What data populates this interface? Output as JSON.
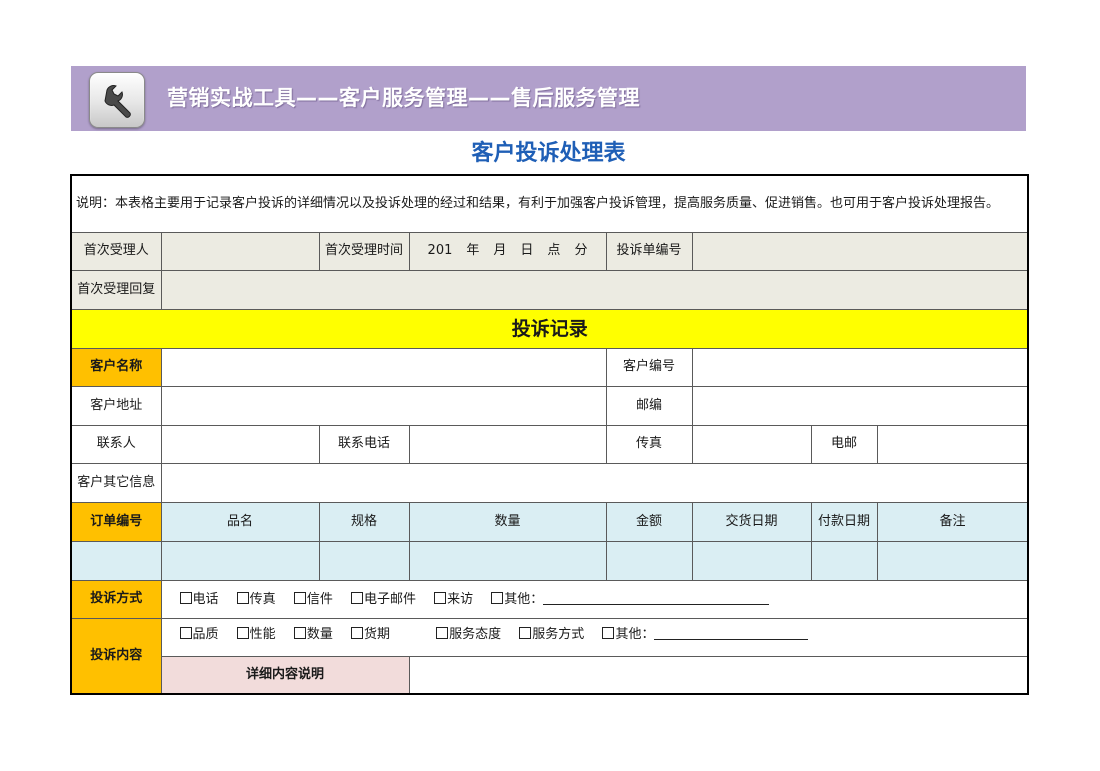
{
  "banner": {
    "title": "营销实战工具——客户服务管理——售后服务管理",
    "icon": "wrench-icon"
  },
  "doc_title": "客户投诉处理表",
  "note": "说明：本表格主要用于记录客户投诉的详细情况以及投诉处理的经过和结果，有利于加强客户投诉管理，提高服务质量、促进销售。也可用于客户投诉处理报告。",
  "first": {
    "receiver_label": "首次受理人",
    "time_label": "首次受理时间",
    "time_parts": [
      "201",
      "年",
      "月",
      "日",
      "点",
      "分"
    ],
    "ticket_label": "投诉单编号",
    "reply_label": "首次受理回复"
  },
  "record_title": "投诉记录",
  "customer": {
    "name_label": "客户名称",
    "code_label": "客户编号",
    "address_label": "客户地址",
    "zip_label": "邮编",
    "contact_label": "联系人",
    "phone_label": "联系电话",
    "fax_label": "传真",
    "email_label": "电邮",
    "other_label": "客户其它信息"
  },
  "order": {
    "headers": [
      "订单编号",
      "品名",
      "规格",
      "数量",
      "金额",
      "交货日期",
      "付款日期",
      "备注"
    ]
  },
  "method": {
    "label": "投诉方式",
    "options": [
      "电话",
      "传真",
      "信件",
      "电子邮件",
      "来访",
      "其他："
    ]
  },
  "content": {
    "label": "投诉内容",
    "options": [
      "品质",
      "性能",
      "数量",
      "货期",
      "服务态度",
      "服务方式",
      "其他："
    ],
    "detail_label": "详细内容说明"
  },
  "colors": {
    "banner": "#b1a0cb",
    "title": "#1f5fb6",
    "yellow": "#ffff00",
    "orange": "#ffc000",
    "blue": "#daeef3",
    "grey": "#ecebe2",
    "pink": "#f2dcdb"
  }
}
